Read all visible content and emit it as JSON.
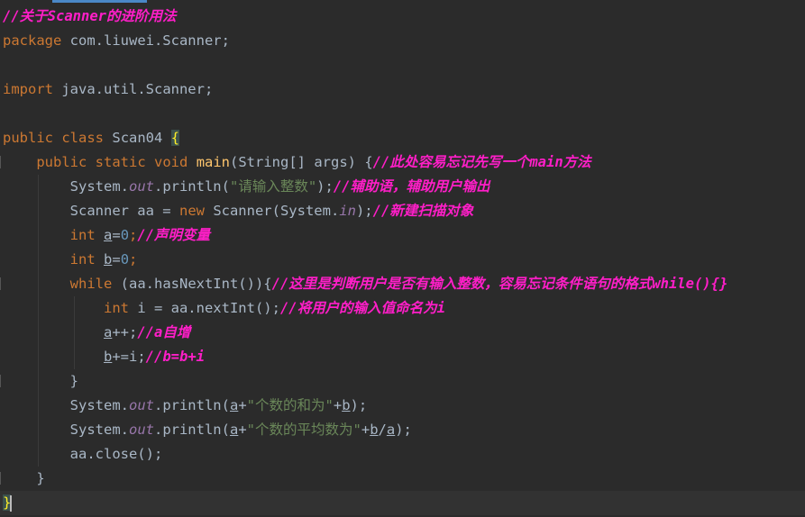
{
  "editor": {
    "lines": [
      {
        "c": "//关于Scanner的进阶用法"
      },
      {
        "kw": "package",
        "rest": " com.liuwei.Scanner;"
      },
      {},
      {
        "kw": "import",
        "rest": " java.util.Scanner;"
      },
      {},
      {
        "kw1": "public",
        "kw2": "class",
        "name": "Scan04",
        "brace": "{"
      },
      {
        "kw1": "public",
        "kw2": "static",
        "kw3": "void",
        "fn": "main",
        "params": "(String[] args) {",
        "c": "//此处容易忘记先写一个main方法"
      },
      {
        "cls": "System.",
        "fld": "out",
        "call": ".println(",
        "str": "\"请输入整数\"",
        "end": ");",
        "c": "//辅助语，辅助用户输出"
      },
      {
        "a": "Scanner aa = ",
        "kw": "new",
        "b": " Scanner(System.",
        "fld": "in",
        "end": ");",
        "c": "//新建扫描对象"
      },
      {
        "kw": "int",
        "var": "a",
        "eq": "=",
        "num": "0",
        "end": ";",
        "c": "//声明变量"
      },
      {
        "kw": "int",
        "var": "b",
        "eq": "=",
        "num": "0",
        "end": ";"
      },
      {
        "kw": "while",
        "rest": " (aa.hasNextInt()){",
        "c": "//这里是判断用户是否有输入整数，容易忘记条件语句的格式while(){}"
      },
      {
        "kw": "int",
        "rest": " i = aa.nextInt();",
        "c": "//将用户的输入值命名为i"
      },
      {
        "var": "a",
        "rest": "++;",
        "c": "//a自增"
      },
      {
        "var": "b",
        "rest": "+=i;",
        "c": "//b=b+i"
      },
      {
        "text": "}"
      },
      {
        "cls": "System.",
        "fld": "out",
        "call": ".println(",
        "v1": "a",
        "plus": "+",
        "str": "\"个数的和为\"",
        "plus2": "+",
        "v2": "b",
        "end": ");"
      },
      {
        "cls": "System.",
        "fld": "out",
        "call": ".println(",
        "v1": "a",
        "plus": "+",
        "str": "\"个数的平均数为\"",
        "plus2": "+",
        "v2": "b",
        "slash": "/",
        "v3": "a",
        "end": ");"
      },
      {
        "text": "aa.close();"
      },
      {
        "text": "}"
      },
      {
        "text": "}"
      }
    ]
  }
}
